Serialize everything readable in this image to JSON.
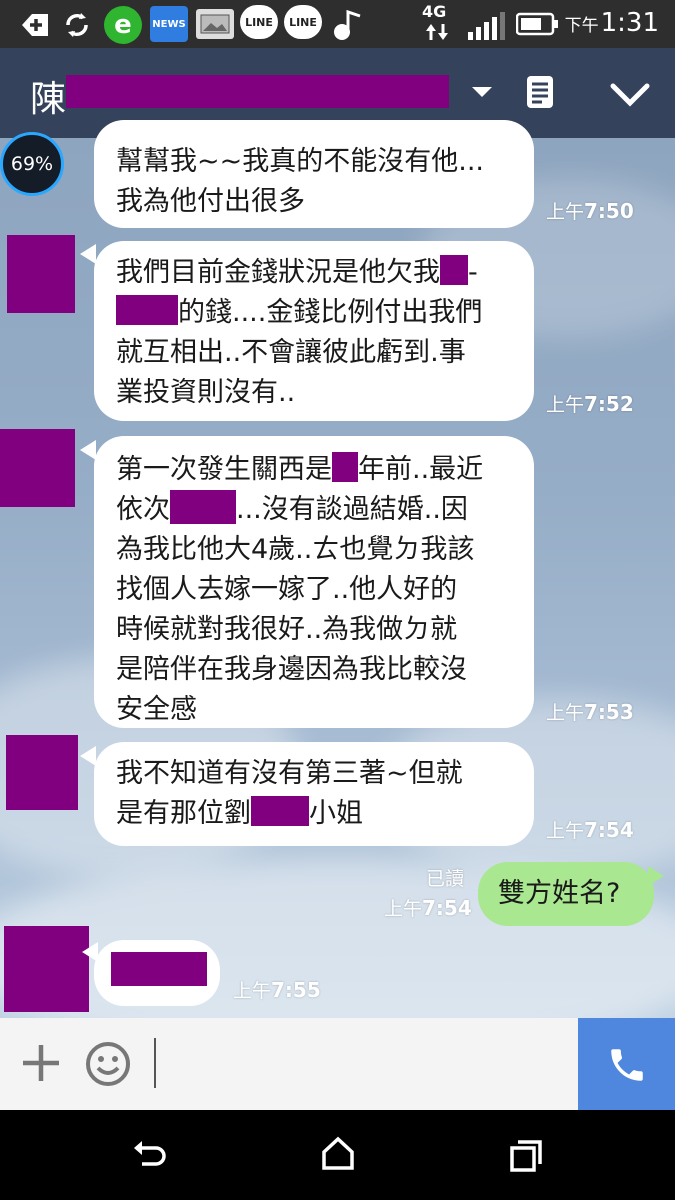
{
  "status_bar": {
    "left_icons": [
      "add-icon",
      "sync-icon",
      "browser-icon",
      "news-icon",
      "gallery-icon",
      "line-icon",
      "line-icon",
      "music-icon"
    ],
    "news_label": "NEWS",
    "line_label": "LINE",
    "network": "4G",
    "time_prefix": "下午",
    "time": "1:31"
  },
  "header": {
    "title_visible": "陳",
    "dropdown_icon": "chevron-down-icon",
    "notes_icon": "notes-icon",
    "collapse_icon": "chevron-down-icon"
  },
  "overlay": {
    "battery_percent": "69%"
  },
  "messages": [
    {
      "lines": [
        "幫幫我~~我真的不能沒有他...",
        "我為他付出很多"
      ],
      "time_prefix": "上午",
      "time": "7:50"
    },
    {
      "lines": [
        "我們目前金錢狀況是他欠我",
        "的錢....金錢比例付出我們",
        "就互相出..不會讓彼此虧到.事",
        "業投資則沒有.."
      ],
      "line1_suffix": "-",
      "time_prefix": "上午",
      "time": "7:52"
    },
    {
      "lines": [
        "第一次發生關西是",
        "年前..最近",
        "依次",
        "...沒有談過結婚..因",
        "為我比他大4歲..ㄊ也覺ㄉ我該",
        "找個人去嫁一嫁了..他人好的",
        "時候就對我很好..為我做ㄉ就",
        "是陪伴在我身邊因為我比較沒",
        "安全感"
      ],
      "time_prefix": "上午",
      "time": "7:53"
    },
    {
      "lines": [
        "我不知道有沒有第三著~但就",
        "是有那位劉",
        "小姐"
      ],
      "time_prefix": "上午",
      "time": "7:54"
    },
    {
      "text": "雙方姓名?",
      "read_label": "已讀",
      "time_prefix": "上午",
      "time": "7:54"
    },
    {
      "time_prefix": "上午",
      "time": "7:55"
    }
  ],
  "input_bar": {
    "add_icon": "plus-icon",
    "emoji_icon": "emoji-icon",
    "call_icon": "phone-icon"
  },
  "nav_bar": [
    "back-icon",
    "home-icon",
    "recents-icon"
  ]
}
